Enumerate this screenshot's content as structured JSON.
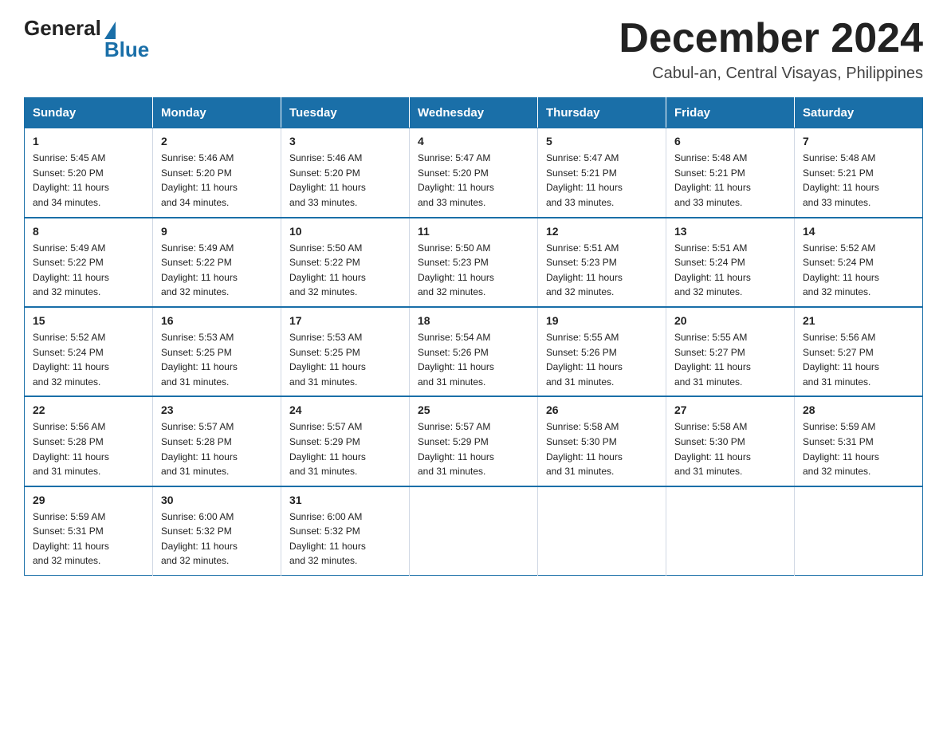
{
  "logo": {
    "general": "General",
    "blue": "Blue"
  },
  "header": {
    "title": "December 2024",
    "subtitle": "Cabul-an, Central Visayas, Philippines"
  },
  "days": [
    "Sunday",
    "Monday",
    "Tuesday",
    "Wednesday",
    "Thursday",
    "Friday",
    "Saturday"
  ],
  "weeks": [
    [
      {
        "day": "1",
        "sunrise": "5:45 AM",
        "sunset": "5:20 PM",
        "daylight": "11 hours and 34 minutes."
      },
      {
        "day": "2",
        "sunrise": "5:46 AM",
        "sunset": "5:20 PM",
        "daylight": "11 hours and 34 minutes."
      },
      {
        "day": "3",
        "sunrise": "5:46 AM",
        "sunset": "5:20 PM",
        "daylight": "11 hours and 33 minutes."
      },
      {
        "day": "4",
        "sunrise": "5:47 AM",
        "sunset": "5:20 PM",
        "daylight": "11 hours and 33 minutes."
      },
      {
        "day": "5",
        "sunrise": "5:47 AM",
        "sunset": "5:21 PM",
        "daylight": "11 hours and 33 minutes."
      },
      {
        "day": "6",
        "sunrise": "5:48 AM",
        "sunset": "5:21 PM",
        "daylight": "11 hours and 33 minutes."
      },
      {
        "day": "7",
        "sunrise": "5:48 AM",
        "sunset": "5:21 PM",
        "daylight": "11 hours and 33 minutes."
      }
    ],
    [
      {
        "day": "8",
        "sunrise": "5:49 AM",
        "sunset": "5:22 PM",
        "daylight": "11 hours and 32 minutes."
      },
      {
        "day": "9",
        "sunrise": "5:49 AM",
        "sunset": "5:22 PM",
        "daylight": "11 hours and 32 minutes."
      },
      {
        "day": "10",
        "sunrise": "5:50 AM",
        "sunset": "5:22 PM",
        "daylight": "11 hours and 32 minutes."
      },
      {
        "day": "11",
        "sunrise": "5:50 AM",
        "sunset": "5:23 PM",
        "daylight": "11 hours and 32 minutes."
      },
      {
        "day": "12",
        "sunrise": "5:51 AM",
        "sunset": "5:23 PM",
        "daylight": "11 hours and 32 minutes."
      },
      {
        "day": "13",
        "sunrise": "5:51 AM",
        "sunset": "5:24 PM",
        "daylight": "11 hours and 32 minutes."
      },
      {
        "day": "14",
        "sunrise": "5:52 AM",
        "sunset": "5:24 PM",
        "daylight": "11 hours and 32 minutes."
      }
    ],
    [
      {
        "day": "15",
        "sunrise": "5:52 AM",
        "sunset": "5:24 PM",
        "daylight": "11 hours and 32 minutes."
      },
      {
        "day": "16",
        "sunrise": "5:53 AM",
        "sunset": "5:25 PM",
        "daylight": "11 hours and 31 minutes."
      },
      {
        "day": "17",
        "sunrise": "5:53 AM",
        "sunset": "5:25 PM",
        "daylight": "11 hours and 31 minutes."
      },
      {
        "day": "18",
        "sunrise": "5:54 AM",
        "sunset": "5:26 PM",
        "daylight": "11 hours and 31 minutes."
      },
      {
        "day": "19",
        "sunrise": "5:55 AM",
        "sunset": "5:26 PM",
        "daylight": "11 hours and 31 minutes."
      },
      {
        "day": "20",
        "sunrise": "5:55 AM",
        "sunset": "5:27 PM",
        "daylight": "11 hours and 31 minutes."
      },
      {
        "day": "21",
        "sunrise": "5:56 AM",
        "sunset": "5:27 PM",
        "daylight": "11 hours and 31 minutes."
      }
    ],
    [
      {
        "day": "22",
        "sunrise": "5:56 AM",
        "sunset": "5:28 PM",
        "daylight": "11 hours and 31 minutes."
      },
      {
        "day": "23",
        "sunrise": "5:57 AM",
        "sunset": "5:28 PM",
        "daylight": "11 hours and 31 minutes."
      },
      {
        "day": "24",
        "sunrise": "5:57 AM",
        "sunset": "5:29 PM",
        "daylight": "11 hours and 31 minutes."
      },
      {
        "day": "25",
        "sunrise": "5:57 AM",
        "sunset": "5:29 PM",
        "daylight": "11 hours and 31 minutes."
      },
      {
        "day": "26",
        "sunrise": "5:58 AM",
        "sunset": "5:30 PM",
        "daylight": "11 hours and 31 minutes."
      },
      {
        "day": "27",
        "sunrise": "5:58 AM",
        "sunset": "5:30 PM",
        "daylight": "11 hours and 31 minutes."
      },
      {
        "day": "28",
        "sunrise": "5:59 AM",
        "sunset": "5:31 PM",
        "daylight": "11 hours and 32 minutes."
      }
    ],
    [
      {
        "day": "29",
        "sunrise": "5:59 AM",
        "sunset": "5:31 PM",
        "daylight": "11 hours and 32 minutes."
      },
      {
        "day": "30",
        "sunrise": "6:00 AM",
        "sunset": "5:32 PM",
        "daylight": "11 hours and 32 minutes."
      },
      {
        "day": "31",
        "sunrise": "6:00 AM",
        "sunset": "5:32 PM",
        "daylight": "11 hours and 32 minutes."
      },
      null,
      null,
      null,
      null
    ]
  ],
  "labels": {
    "sunrise": "Sunrise:",
    "sunset": "Sunset:",
    "daylight": "Daylight:"
  }
}
